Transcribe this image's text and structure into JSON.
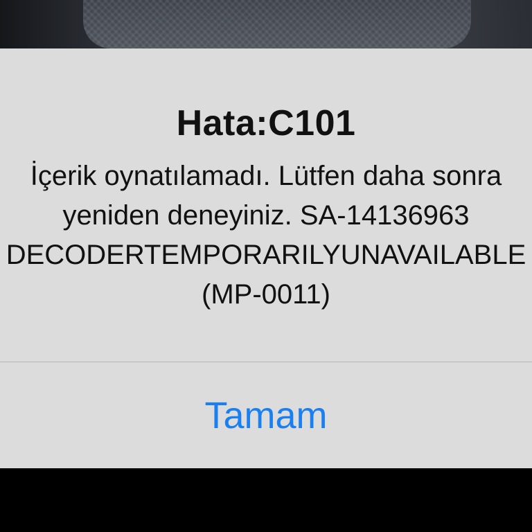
{
  "alert": {
    "title": "Hata:C101",
    "message_lines": [
      "İçerik oynatılamadı. Lütfen daha sonra",
      "yeniden deneyiniz. SA-14136963",
      "DECODERTEMPORARILYUNAVAILABLE",
      "(MP-0011)"
    ],
    "button_label": "Tamam"
  },
  "colors": {
    "accent": "#1a7ff0",
    "alert_background": "#dcdcdc",
    "divider": "#b3b3b3",
    "text": "#111111"
  }
}
